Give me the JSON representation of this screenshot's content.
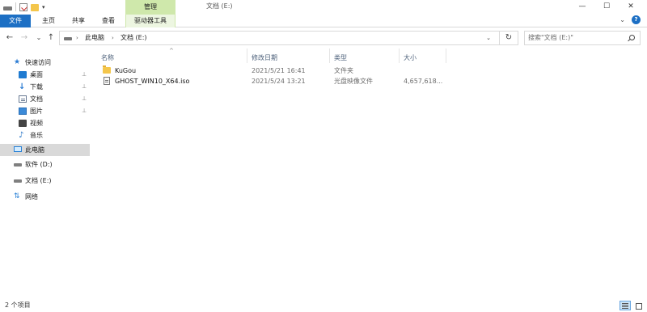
{
  "window": {
    "manage_tab": "管理",
    "title": "文档 (E:)",
    "minimize": "—",
    "maximize": "☐",
    "close": "✕"
  },
  "ribbon": {
    "tabs": [
      "文件",
      "主页",
      "共享",
      "查看"
    ],
    "tools_tab": "驱动器工具",
    "expand": "⌄",
    "help": "?"
  },
  "address": {
    "back": "←",
    "forward": "→",
    "recent": "⌄",
    "up": "↑",
    "crumbs": [
      "此电脑",
      "文档 (E:)"
    ],
    "dropdown": "⌄",
    "refresh": "↻"
  },
  "search": {
    "placeholder": "搜索\"文档 (E:)\""
  },
  "navigation": {
    "items": [
      {
        "label": "快速访问",
        "icon": "star-icon"
      },
      {
        "label": "桌面",
        "icon": "desktop-icon",
        "pinned": true
      },
      {
        "label": "下载",
        "icon": "download-icon",
        "pinned": true
      },
      {
        "label": "文档",
        "icon": "document-icon",
        "pinned": true
      },
      {
        "label": "图片",
        "icon": "picture-icon",
        "pinned": true
      },
      {
        "label": "视频",
        "icon": "video-icon"
      },
      {
        "label": "音乐",
        "icon": "music-icon"
      },
      {
        "label": "此电脑",
        "icon": "pc-icon",
        "selected": true
      },
      {
        "label": "软件 (D:)",
        "icon": "drive-icon"
      },
      {
        "label": "文档 (E:)",
        "icon": "drive-icon"
      },
      {
        "label": "网络",
        "icon": "network-icon"
      }
    ],
    "pin_glyph": "📌"
  },
  "columns": {
    "name": "名称",
    "modified": "修改日期",
    "type": "类型",
    "size": "大小",
    "sort_glyph": "^"
  },
  "files": [
    {
      "name": "KuGou",
      "modified": "2021/5/21 16:41",
      "type": "文件夹",
      "size": "",
      "icon": "folder-icon"
    },
    {
      "name": "GHOST_WIN10_X64.iso",
      "modified": "2021/5/24 13:21",
      "type": "光盘映像文件",
      "size": "4,657,618...",
      "icon": "iso-file-icon"
    }
  ],
  "status": {
    "count": "2 个项目"
  },
  "colors": {
    "accent": "#1c6fc4",
    "manage_tab": "#cfe8ab",
    "selected_nav": "#d9d9d9"
  }
}
